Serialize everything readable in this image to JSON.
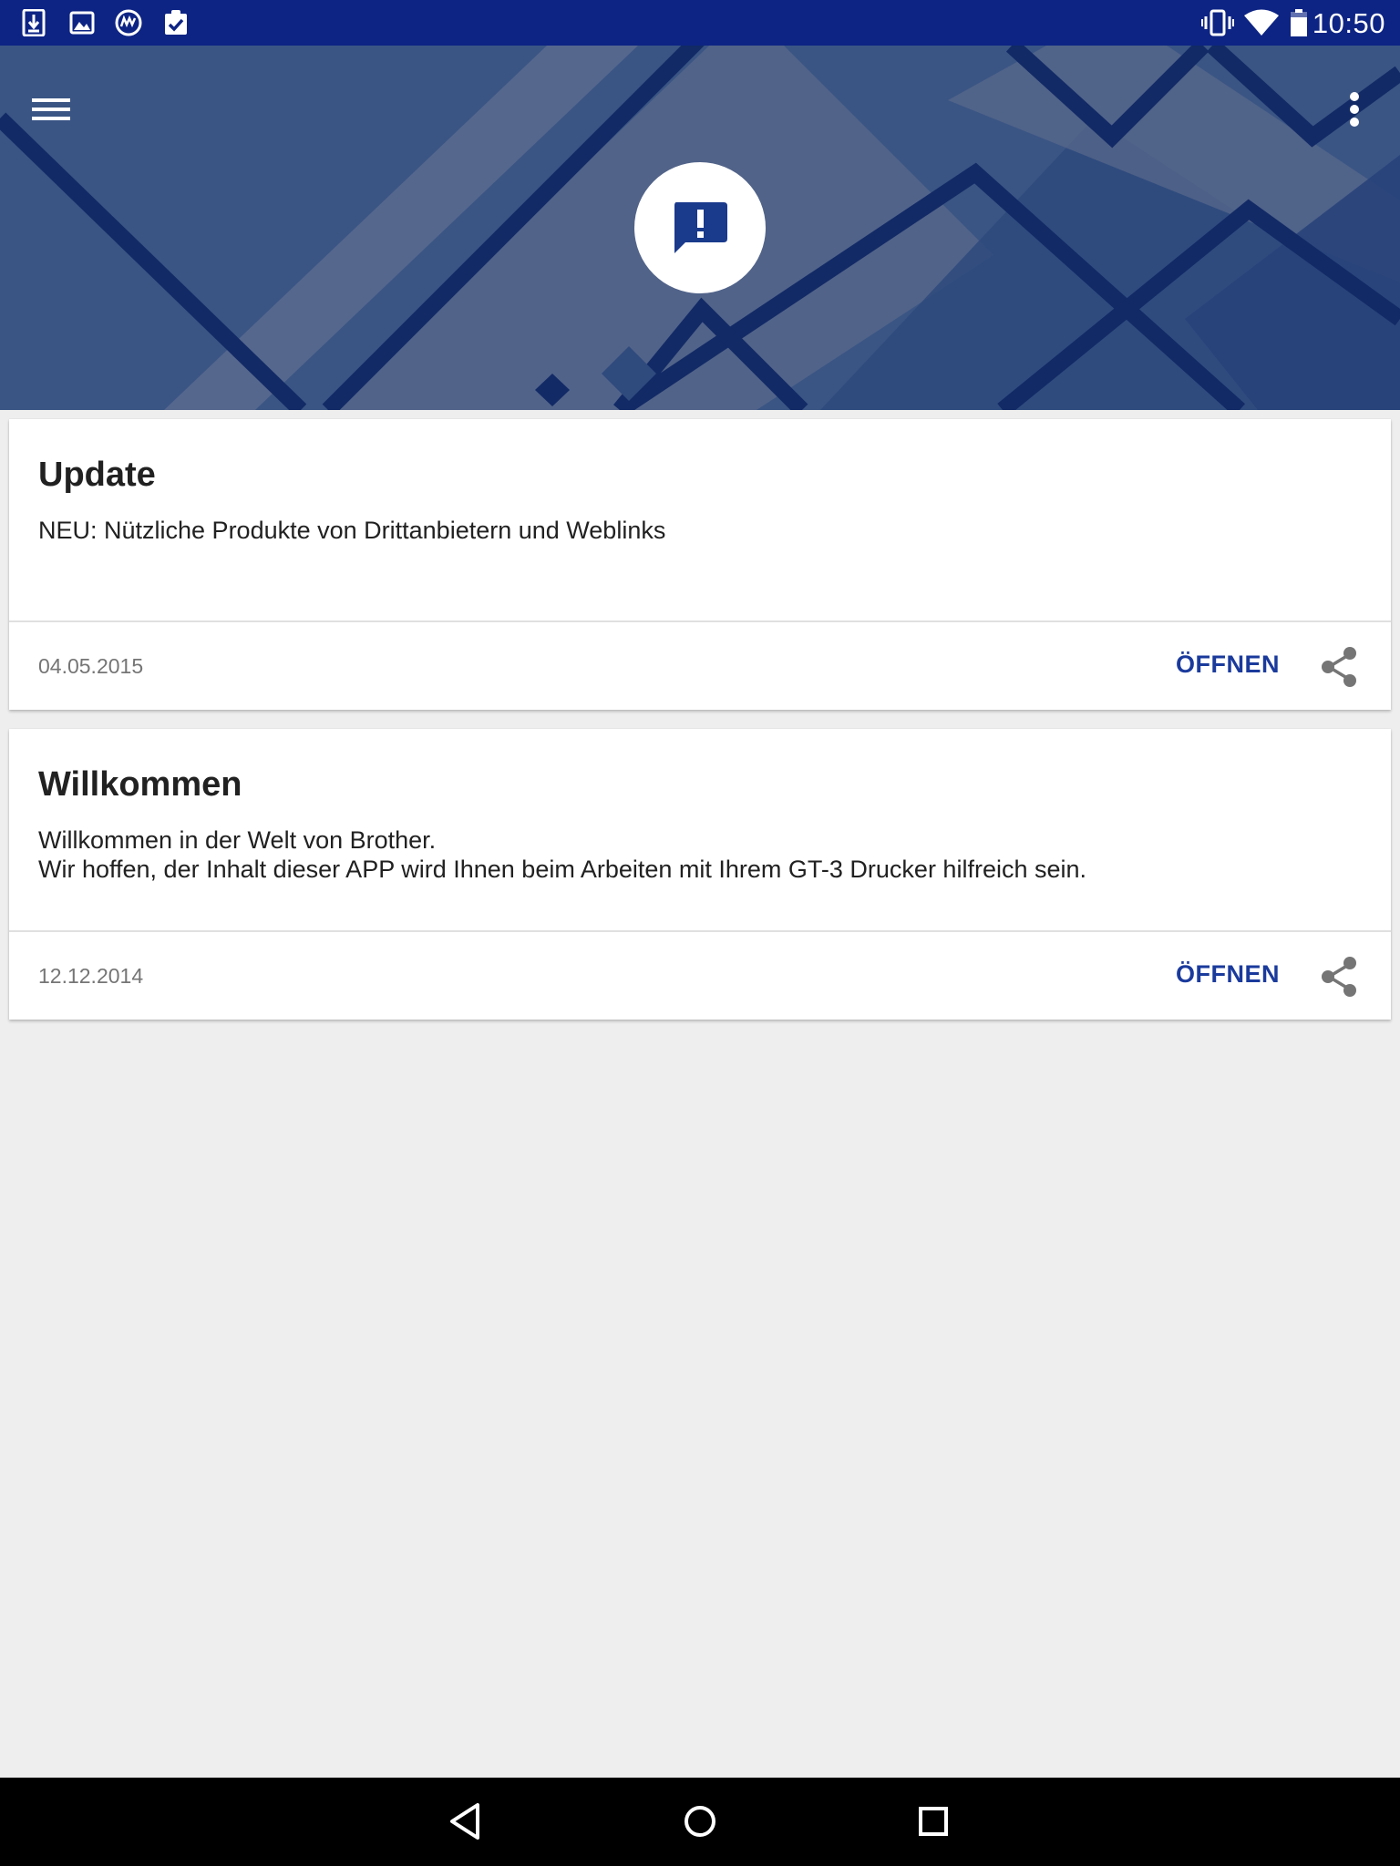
{
  "status_bar": {
    "time": "10:50",
    "left_icons": [
      "download-icon",
      "image-icon",
      "app-logo-icon",
      "clipboard-check-icon"
    ],
    "right_icons": [
      "vibrate-icon",
      "wifi-icon",
      "battery-icon"
    ]
  },
  "header": {
    "menu_icon": "hamburger-menu-icon",
    "overflow_icon": "more-vert-icon",
    "badge_icon": "announcement-icon",
    "colors": {
      "background": "#3a5584",
      "dark_lines": "#122a66",
      "badge_icon": "#1a3a8c"
    }
  },
  "cards": [
    {
      "title": "Update",
      "body": "NEU: Nützliche Produkte von Drittanbietern und Weblinks",
      "date": "04.05.2015",
      "open_label": "ÖFFNEN",
      "share_icon": "share-icon"
    },
    {
      "title": "Willkommen",
      "body": "Willkommen in der Welt von Brother.\nWir hoffen, der Inhalt dieser APP wird Ihnen beim Arbeiten mit Ihrem GT-3 Drucker hilfreich sein.",
      "date": "12.12.2014",
      "open_label": "ÖFFNEN",
      "share_icon": "share-icon"
    }
  ],
  "nav_bar": {
    "buttons": [
      "back-icon",
      "home-icon",
      "recents-icon"
    ]
  },
  "colors": {
    "status_bar": "#0d2484",
    "accent": "#1a3a9c",
    "page_background": "#eeeeee"
  }
}
